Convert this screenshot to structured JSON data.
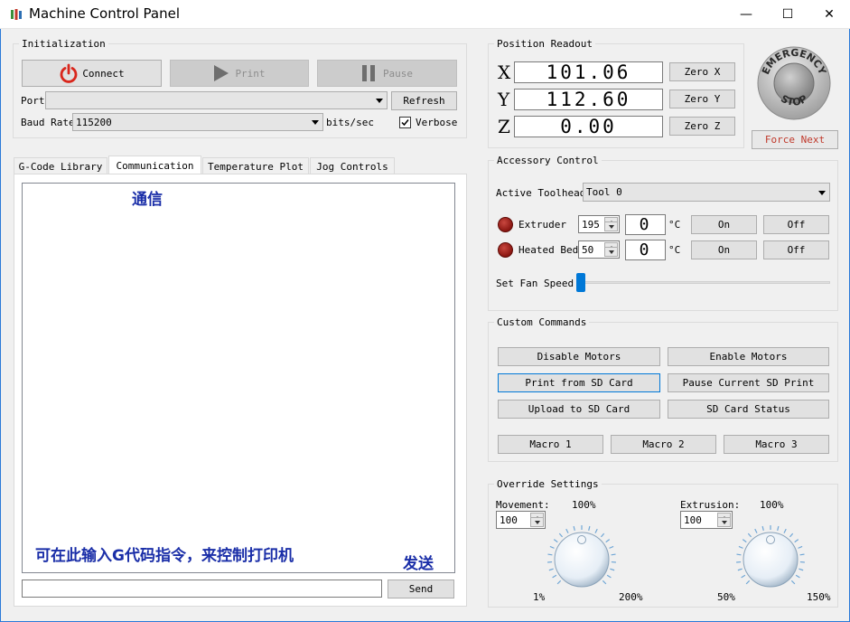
{
  "window": {
    "title": "Machine Control Panel",
    "minimize": "—",
    "maximize": "☐",
    "close": "✕"
  },
  "init": {
    "group_label": "Initialization",
    "connect_label": "Connect",
    "print_label": "Print",
    "pause_label": "Pause",
    "port_label": "Port",
    "port_value": "",
    "refresh_label": "Refresh",
    "baud_label": "Baud Rate",
    "baud_value": "115200",
    "bits_label": "bits/sec",
    "verbose_label": "Verbose",
    "verbose_checked": true
  },
  "tabs": [
    {
      "label": "G-Code Library",
      "active": false
    },
    {
      "label": "Communication",
      "active": true
    },
    {
      "label": "Temperature Plot",
      "active": false
    },
    {
      "label": "Jog Controls",
      "active": false
    }
  ],
  "comm": {
    "log_text": "",
    "command_value": "",
    "send_label": "Send",
    "annotation_title": "通信",
    "annotation_input": "可在此输入G代码指令，来控制打印机",
    "annotation_send": "发送"
  },
  "position": {
    "group_label": "Position Readout",
    "axes": [
      {
        "axis": "X",
        "value": "101.06",
        "zero_label": "Zero X"
      },
      {
        "axis": "Y",
        "value": "112.60",
        "zero_label": "Zero Y"
      },
      {
        "axis": "Z",
        "value": "0.00",
        "zero_label": "Zero Z"
      }
    ]
  },
  "estop": {
    "text_top": "EMERGENCY",
    "text_bottom": "STOP",
    "force_next_label": "Force Next"
  },
  "accessory": {
    "group_label": "Accessory Control",
    "toolhead_label": "Active Toolhead",
    "toolhead_value": "Tool 0",
    "heaters": [
      {
        "label": "Extruder",
        "setpoint": "195",
        "current": "0",
        "unit": "°C",
        "on_label": "On",
        "off_label": "Off"
      },
      {
        "label": "Heated Bed",
        "setpoint": "50",
        "current": "0",
        "unit": "°C",
        "on_label": "On",
        "off_label": "Off"
      }
    ],
    "fan_label": "Set Fan Speed",
    "fan_level": 0
  },
  "custom": {
    "group_label": "Custom Commands",
    "buttons": [
      "Disable Motors",
      "Enable Motors",
      "Print from SD Card",
      "Pause Current SD Print",
      "Upload to SD Card",
      "SD Card Status"
    ],
    "macros": [
      "Macro 1",
      "Macro 2",
      "Macro 3"
    ]
  },
  "override": {
    "group_label": "Override Settings",
    "movement": {
      "label": "Movement:",
      "value": "100",
      "current": "100%",
      "min": "1%",
      "max": "200%"
    },
    "extrusion": {
      "label": "Extrusion:",
      "value": "100",
      "current": "100%",
      "min": "50%",
      "max": "150%"
    }
  },
  "colors": {
    "accent": "#0078d7",
    "title_border": "#2b79d8",
    "annotation": "#1a2ea8",
    "power_icon": "#d9261c",
    "force_next": "#c0392b"
  }
}
